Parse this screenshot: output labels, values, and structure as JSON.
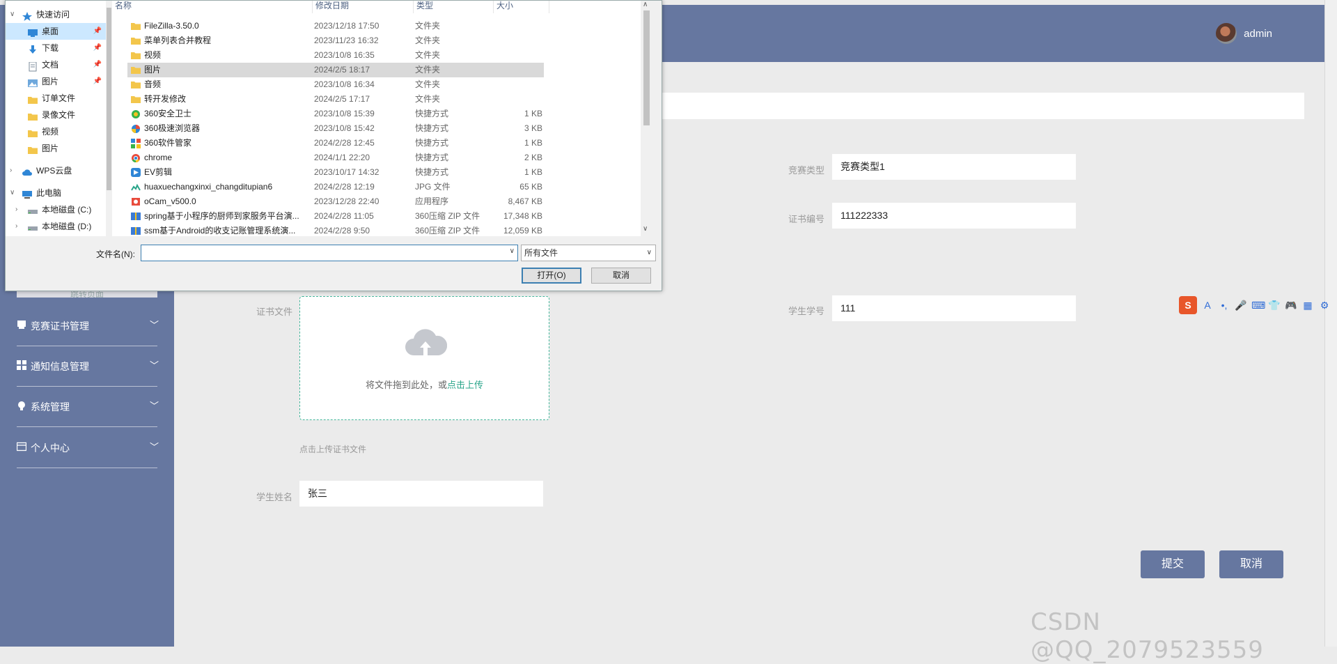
{
  "header": {
    "username": "admin"
  },
  "sidebar": {
    "ghost_button": "跳转页面",
    "menu": [
      {
        "label": "竞赛证书管理",
        "icon": "certificate-icon"
      },
      {
        "label": "通知信息管理",
        "icon": "grid-icon"
      },
      {
        "label": "系统管理",
        "icon": "bulb-icon"
      },
      {
        "label": "个人中心",
        "icon": "profile-card-icon"
      }
    ]
  },
  "form": {
    "competition_type": {
      "label": "竞赛类型",
      "value": "竞赛类型1"
    },
    "certificate_no": {
      "label": "证书编号",
      "value": "111222333"
    },
    "student_no": {
      "label": "学生学号",
      "value": "111"
    },
    "certificate_file": {
      "label": "证书文件",
      "drop_text": "将文件拖到此处，或",
      "click_text": "点击上传",
      "hint": "点击上传证书文件"
    },
    "student_name": {
      "label": "学生姓名",
      "value": "张三"
    },
    "submit": "提交",
    "cancel": "取消"
  },
  "watermark": "CSDN @QQ_2079523559",
  "dialog": {
    "nav": [
      {
        "label": "快速访问",
        "icon": "star-icon",
        "level": 0,
        "expanded": true
      },
      {
        "label": "桌面",
        "icon": "desktop-icon",
        "level": 1,
        "pinned": true,
        "selected": true
      },
      {
        "label": "下载",
        "icon": "download-icon",
        "level": 1,
        "pinned": true
      },
      {
        "label": "文档",
        "icon": "document-icon",
        "level": 1,
        "pinned": true
      },
      {
        "label": "图片",
        "icon": "picture-icon",
        "level": 1,
        "pinned": true
      },
      {
        "label": "订单文件",
        "icon": "folder-icon",
        "level": 1
      },
      {
        "label": "录像文件",
        "icon": "folder-icon",
        "level": 1
      },
      {
        "label": "视频",
        "icon": "folder-icon",
        "level": 1
      },
      {
        "label": "图片",
        "icon": "folder-icon",
        "level": 1
      },
      {
        "label": "WPS云盘",
        "icon": "cloud-icon",
        "level": 0,
        "expanded": false
      },
      {
        "label": "此电脑",
        "icon": "computer-icon",
        "level": 0,
        "expanded": true
      },
      {
        "label": "本地磁盘 (C:)",
        "icon": "drive-icon",
        "level": 1,
        "expanded": false
      },
      {
        "label": "本地磁盘 (D:)",
        "icon": "drive-icon",
        "level": 1,
        "expanded": false
      }
    ],
    "columns": [
      "名称",
      "修改日期",
      "类型",
      "大小"
    ],
    "files": [
      {
        "name": "FileZilla-3.50.0",
        "date": "2023/12/18 17:50",
        "type": "文件夹",
        "size": "",
        "icon": "folder-icon"
      },
      {
        "name": "菜单列表合并教程",
        "date": "2023/11/23 16:32",
        "type": "文件夹",
        "size": "",
        "icon": "folder-icon"
      },
      {
        "name": "视频",
        "date": "2023/10/8 16:35",
        "type": "文件夹",
        "size": "",
        "icon": "folder-icon"
      },
      {
        "name": "图片",
        "date": "2024/2/5 18:17",
        "type": "文件夹",
        "size": "",
        "icon": "folder-icon",
        "selected": true
      },
      {
        "name": "音频",
        "date": "2023/10/8 16:34",
        "type": "文件夹",
        "size": "",
        "icon": "folder-icon"
      },
      {
        "name": "转开发修改",
        "date": "2024/2/5 17:17",
        "type": "文件夹",
        "size": "",
        "icon": "folder-icon"
      },
      {
        "name": "360安全卫士",
        "date": "2023/10/8 15:39",
        "type": "快捷方式",
        "size": "1 KB",
        "icon": "shortcut-360-security-icon"
      },
      {
        "name": "360极速浏览器",
        "date": "2023/10/8 15:42",
        "type": "快捷方式",
        "size": "3 KB",
        "icon": "shortcut-360-browser-icon"
      },
      {
        "name": "360软件管家",
        "date": "2024/2/28 12:45",
        "type": "快捷方式",
        "size": "1 KB",
        "icon": "shortcut-360-software-icon"
      },
      {
        "name": "chrome",
        "date": "2024/1/1 22:20",
        "type": "快捷方式",
        "size": "2 KB",
        "icon": "chrome-icon"
      },
      {
        "name": "EV剪辑",
        "date": "2023/10/17 14:32",
        "type": "快捷方式",
        "size": "1 KB",
        "icon": "ev-editor-icon"
      },
      {
        "name": "huaxuechangxinxi_changditupian6",
        "date": "2024/2/28 12:19",
        "type": "JPG 文件",
        "size": "65 KB",
        "icon": "image-file-icon"
      },
      {
        "name": "oCam_v500.0",
        "date": "2023/12/28 22:40",
        "type": "应用程序",
        "size": "8,467 KB",
        "icon": "app-icon"
      },
      {
        "name": "spring基于小程序的厨师到家服务平台演...",
        "date": "2024/2/28 11:05",
        "type": "360压缩 ZIP 文件",
        "size": "17,348 KB",
        "icon": "zip-icon"
      },
      {
        "name": "ssm基于Android的收支记账管理系统演...",
        "date": "2024/2/28 9:50",
        "type": "360压缩 ZIP 文件",
        "size": "12,059 KB",
        "icon": "zip-icon"
      }
    ],
    "filename_label": "文件名(N):",
    "filename_value": "",
    "filetype": "所有文件",
    "open_button": "打开(O)",
    "cancel_button": "取消"
  },
  "ime": [
    "S",
    "A",
    "•,",
    "🎤",
    "⌨",
    "👕",
    "🎮",
    "▦",
    "⚙"
  ],
  "colors": {
    "sidebar": "#6677a0",
    "accent": "#44b59a",
    "button": "#6677a0"
  }
}
